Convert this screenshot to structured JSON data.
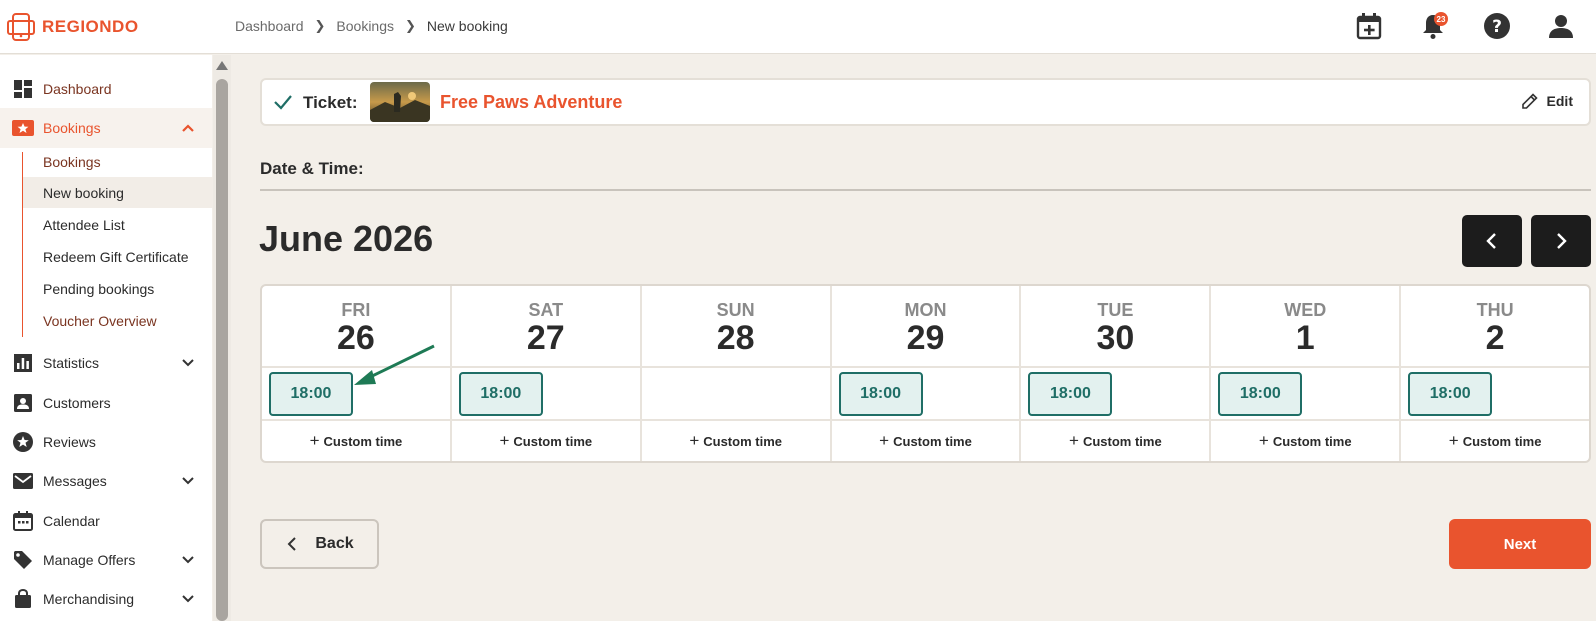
{
  "brand": {
    "name": "REGIONDO",
    "accent": "#e9542e"
  },
  "breadcrumb": [
    "Dashboard",
    "Bookings",
    "New booking"
  ],
  "header_icons": [
    "calendar-add-icon",
    "bell-icon",
    "help-icon",
    "user-icon"
  ],
  "notifications_count": "23",
  "sidebar": {
    "items": [
      {
        "label": "Dashboard",
        "icon": "dashboard-icon"
      },
      {
        "label": "Bookings",
        "icon": "ticket-icon"
      },
      {
        "label": "Statistics",
        "icon": "bar-chart-icon"
      },
      {
        "label": "Customers",
        "icon": "contact-card-icon"
      },
      {
        "label": "Reviews",
        "icon": "star-icon"
      },
      {
        "label": "Messages",
        "icon": "mail-icon"
      },
      {
        "label": "Calendar",
        "icon": "calendar-icon"
      },
      {
        "label": "Manage Offers",
        "icon": "tag-icon"
      },
      {
        "label": "Merchandising",
        "icon": "shopping-bag-icon"
      }
    ],
    "bookings_sub": [
      "Bookings",
      "New booking",
      "Attendee List",
      "Redeem Gift Certificate",
      "Pending bookings",
      "Voucher Overview"
    ]
  },
  "ticket": {
    "label": "Ticket:",
    "name": "Free Paws Adventure",
    "edit_label": "Edit"
  },
  "datetime_label": "Date & Time:",
  "month_label": "June 2026",
  "days": [
    {
      "name": "FRI",
      "num": "26",
      "slot": "18:00"
    },
    {
      "name": "SAT",
      "num": "27",
      "slot": "18:00"
    },
    {
      "name": "SUN",
      "num": "28",
      "slot": ""
    },
    {
      "name": "MON",
      "num": "29",
      "slot": "18:00"
    },
    {
      "name": "TUE",
      "num": "30",
      "slot": "18:00"
    },
    {
      "name": "WED",
      "num": "1",
      "slot": "18:00"
    },
    {
      "name": "THU",
      "num": "2",
      "slot": "18:00"
    }
  ],
  "custom_time_label": "Custom time",
  "back_label": "Back",
  "next_label": "Next"
}
